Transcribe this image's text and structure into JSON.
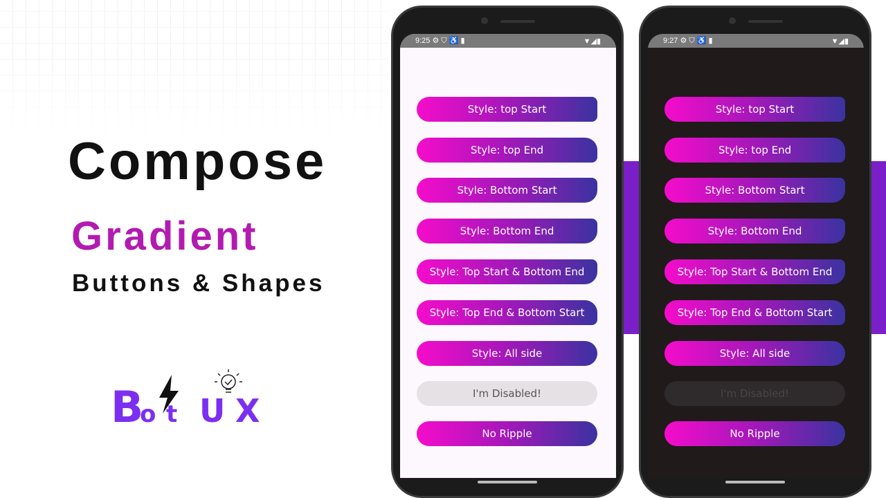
{
  "headline": {
    "line1": "Compose",
    "line2": "Gradient",
    "line3": "Buttons & Shapes"
  },
  "logo": {
    "text": "BotUX"
  },
  "colors": {
    "gradient_start": "#f50ccb",
    "gradient_end": "#3a33a0",
    "accent_band": "#7a1fc9",
    "title_accent": "#b21bb0"
  },
  "phones": [
    {
      "theme": "light",
      "time": "9:25",
      "background": "#fdf8fd"
    },
    {
      "theme": "dark",
      "time": "9:27",
      "background": "#201a1b"
    }
  ],
  "status_icons": [
    "gear-icon",
    "shield-icon",
    "accessibility-icon",
    "sd-card-icon",
    "wifi-icon",
    "signal-icon",
    "battery-icon"
  ],
  "buttons": [
    {
      "label": "Style: top Start",
      "enabled": true
    },
    {
      "label": "Style: top End",
      "enabled": true
    },
    {
      "label": "Style: Bottom Start",
      "enabled": true
    },
    {
      "label": "Style: Bottom End",
      "enabled": true
    },
    {
      "label": "Style: Top Start & Bottom End",
      "enabled": true
    },
    {
      "label": "Style: Top End & Bottom Start",
      "enabled": true
    },
    {
      "label": "Style: All side",
      "enabled": true
    },
    {
      "label": "I'm Disabled!",
      "enabled": false
    },
    {
      "label": "No Ripple",
      "enabled": true
    }
  ]
}
